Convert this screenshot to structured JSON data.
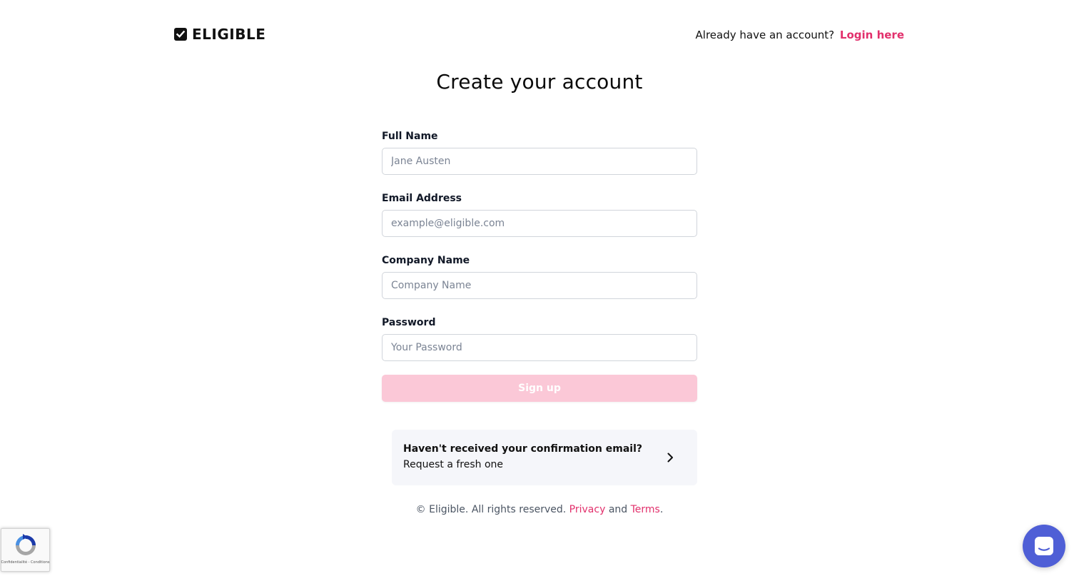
{
  "header": {
    "logo_text": "ELIGIBLE",
    "login_prompt": "Already have an account?",
    "login_link": "Login here"
  },
  "title": "Create your account",
  "form": {
    "full_name": {
      "label": "Full Name",
      "placeholder": "Jane Austen",
      "value": ""
    },
    "email": {
      "label": "Email Address",
      "placeholder": "example@eligible.com",
      "value": ""
    },
    "company": {
      "label": "Company Name",
      "placeholder": "Company Name",
      "value": ""
    },
    "password": {
      "label": "Password",
      "placeholder": "Your Password",
      "value": ""
    },
    "submit_label": "Sign up"
  },
  "confirmation": {
    "title": "Haven't received your confirmation email?",
    "subtitle": "Request a fresh one",
    "icon": "chevron-right-icon"
  },
  "footer": {
    "copyright": "© Eligible. All rights reserved.",
    "privacy": "Privacy",
    "and": "and",
    "terms": "Terms",
    "period": "."
  },
  "recaptcha": {
    "terms": "Confidentialité - Conditions"
  },
  "colors": {
    "accent": "#e2306c",
    "button_disabled": "#fbc8d7",
    "chat": "#4f5fd6",
    "panel": "#f5f6fa"
  },
  "icons": {
    "logo": "checkbox-icon",
    "recaptcha": "recaptcha-icon",
    "chat": "chat-icon"
  }
}
